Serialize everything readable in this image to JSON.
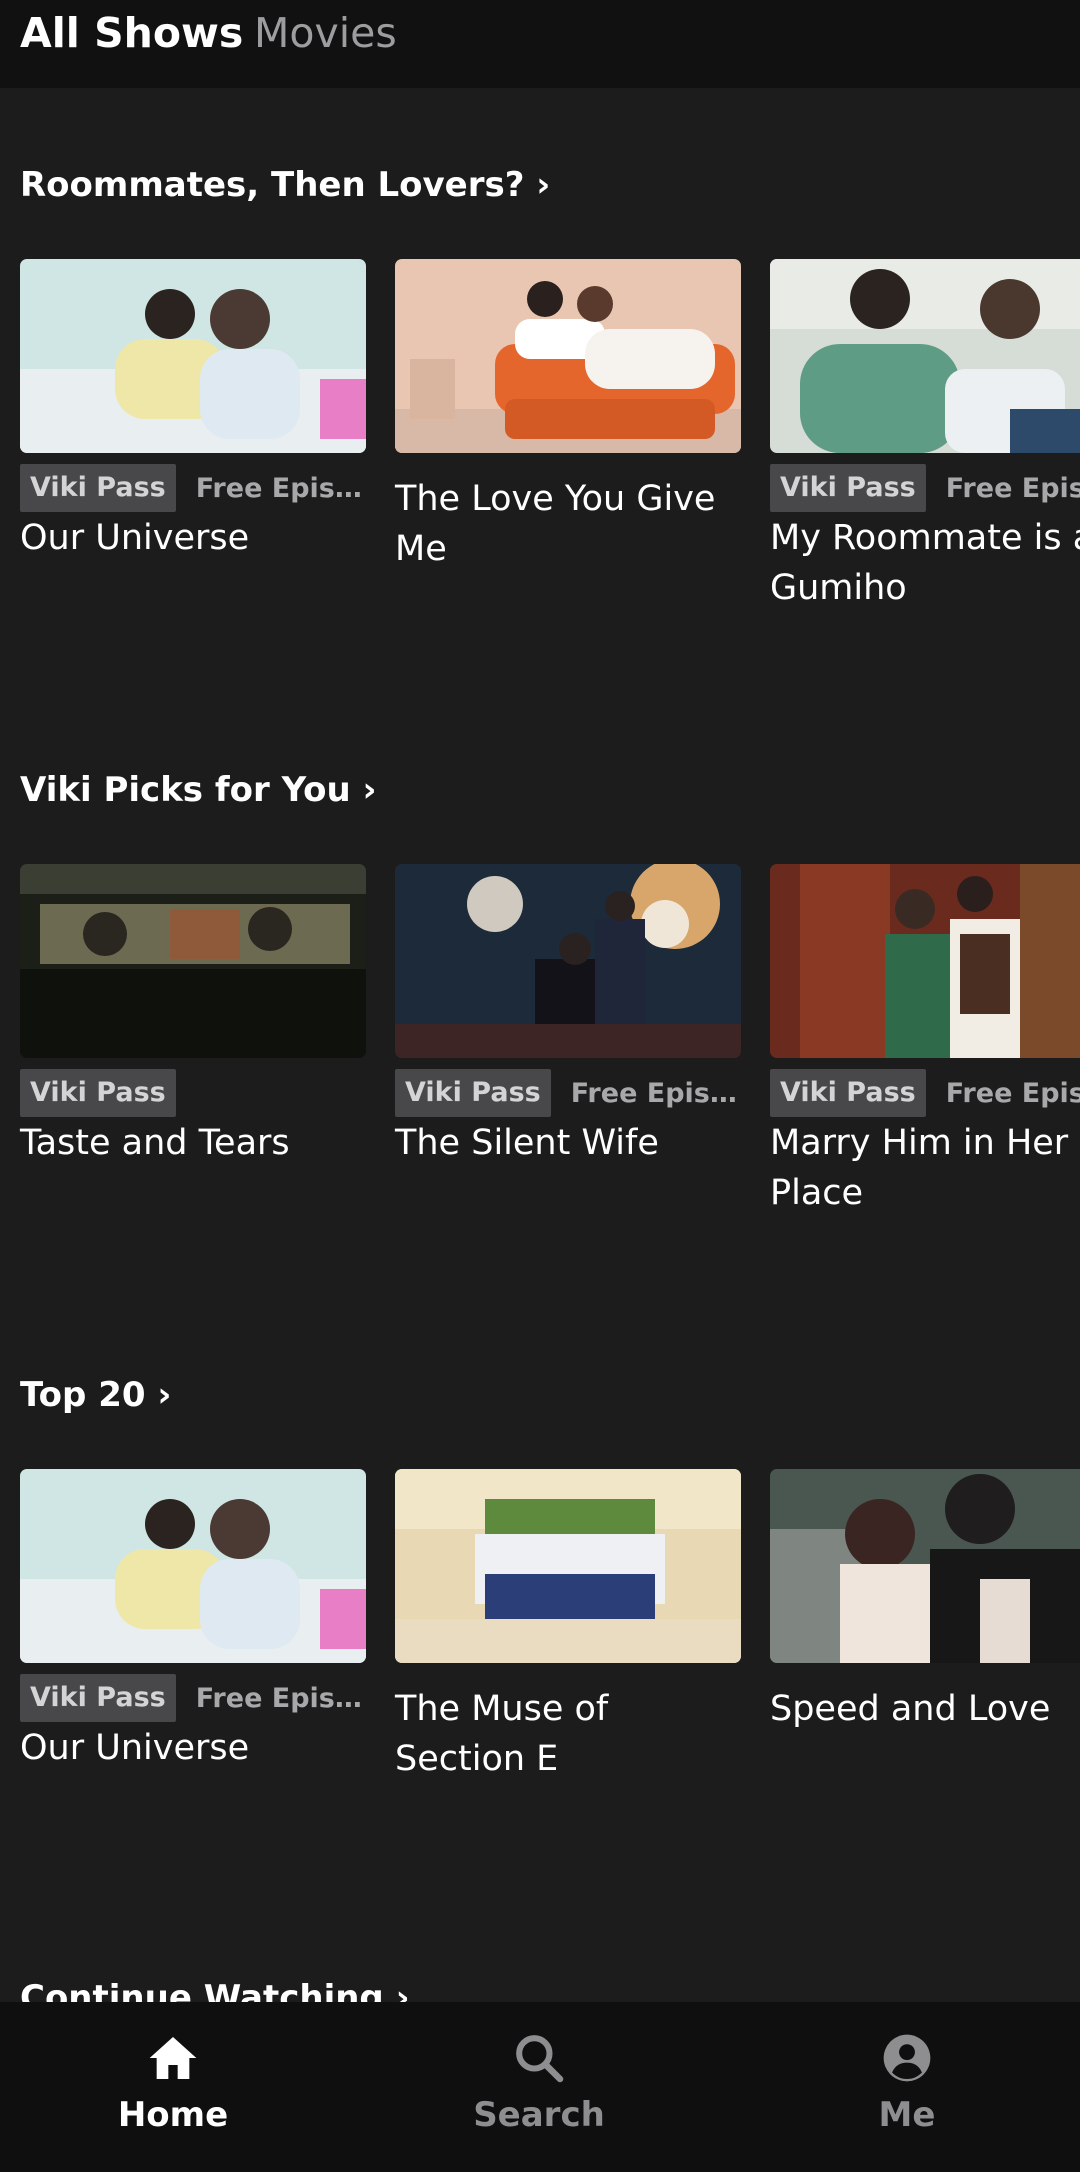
{
  "top_tabs": {
    "active": "All Shows",
    "inactive": "Movies"
  },
  "sections": [
    {
      "title": "Roommates, Then Lovers? ›",
      "cards": [
        {
          "title": "Our Universe",
          "badge": "Viki Pass",
          "free": "Free Episo..."
        },
        {
          "title": "The Love You Give Me",
          "badge": "",
          "free": ""
        },
        {
          "title": "My Roommate is a Gumiho",
          "badge": "Viki Pass",
          "free": "Free Episo..."
        }
      ]
    },
    {
      "title": "Viki Picks for You ›",
      "cards": [
        {
          "title": "Taste and Tears",
          "badge": "Viki Pass",
          "free": ""
        },
        {
          "title": "The Silent Wife",
          "badge": "Viki Pass",
          "free": "Free Episo..."
        },
        {
          "title": "Marry Him in Her Place",
          "badge": "Viki Pass",
          "free": "Free Episo..."
        }
      ]
    },
    {
      "title": "Top 20 ›",
      "cards": [
        {
          "title": "Our Universe",
          "badge": "Viki Pass",
          "free": "Free Episo..."
        },
        {
          "title": "The Muse of Section E",
          "badge": "",
          "free": ""
        },
        {
          "title": "Speed and Love",
          "badge": "",
          "free": ""
        }
      ]
    },
    {
      "title": "Continue Watching ›"
    }
  ],
  "bottom_nav": {
    "home": "Home",
    "search": "Search",
    "me": "Me"
  },
  "icons": {
    "home": "home-icon",
    "search": "search-icon",
    "me": "account-icon"
  },
  "colors": {
    "background": "#1c1c1d",
    "badge": "#48484a",
    "nav_active": "#ffffff",
    "nav_inactive": "#8e8e90"
  }
}
